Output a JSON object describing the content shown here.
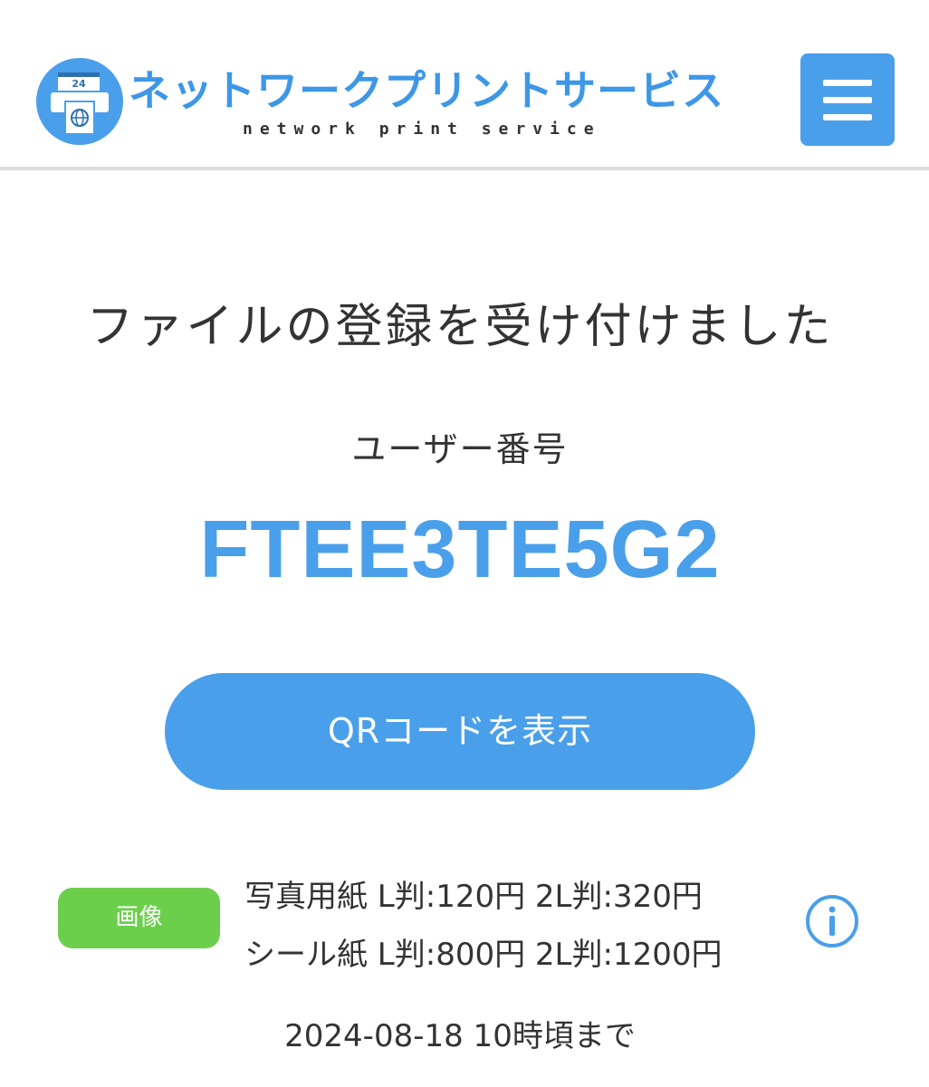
{
  "header": {
    "logo_badge": "24",
    "logo_title": "ネットワークプリントサービス",
    "logo_subtitle": "network print service",
    "menu_icon": "hamburger-icon"
  },
  "main": {
    "title": "ファイルの登録を受け付けました",
    "user_label": "ユーザー番号",
    "user_number": "FTEE3TE5G2",
    "qr_button_label": "QRコードを表示",
    "file_type_badge": "画像",
    "price_line_1": "写真用紙 L判:120円 2L判:320円",
    "price_line_2": "シール紙 L判:800円 2L判:1200円",
    "info_icon": "info-icon",
    "deadline": "2024-08-18 10時頃まで"
  },
  "colors": {
    "accent": "#4a9fea",
    "badge_green": "#6ccf4c",
    "text": "#333333",
    "divider": "#dcdcdc"
  }
}
